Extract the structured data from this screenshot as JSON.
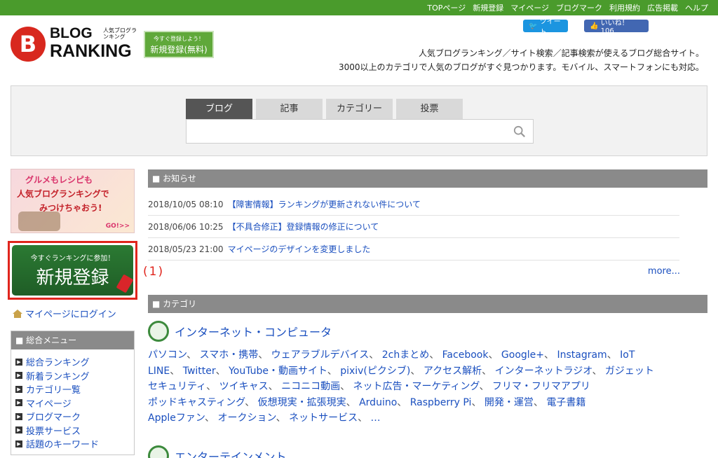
{
  "topnav": [
    "TOPページ",
    "新規登録",
    "マイページ",
    "ブログマーク",
    "利用規約",
    "広告掲載",
    "ヘルプ"
  ],
  "logo": {
    "mark": "B",
    "word1": "BLOG",
    "word2": "RANKING",
    "sub": "人気ブログランキング"
  },
  "header_register": {
    "small": "今すぐ登録しよう！",
    "big": "新規登録(無料)"
  },
  "social": {
    "tweet": "ツイート",
    "like": "いいね！ 106"
  },
  "tagline": [
    "人気ブログランキング／サイト検索／記事検索が使えるブログ総合サイト。",
    "3000以上のカテゴリで人気のブログがすぐ見つかります。モバイル、スマートフォンにも対応。"
  ],
  "search": {
    "tabs": [
      "ブログ",
      "記事",
      "カテゴリー",
      "投票"
    ],
    "active_tab": 0,
    "value": ""
  },
  "banner": {
    "line1": "グルメもレシピも",
    "line2": "人気ブログランキングで",
    "line3": "みつけちゃおう!",
    "go": "GO!>>"
  },
  "join": {
    "small": "今すぐランキングに参加！",
    "big": "新規登録"
  },
  "annotation": "(1)",
  "login": "マイページにログイン",
  "menu": {
    "title": "総合メニュー",
    "items": [
      "総合ランキング",
      "新着ランキング",
      "カテゴリ一覧",
      "マイページ",
      "ブログマーク",
      "投票サービス",
      "話題のキーワード"
    ]
  },
  "news": {
    "title": "お知らせ",
    "items": [
      {
        "date": "2018/10/05 08:10",
        "text": "【障害情報】ランキングが更新されない件について"
      },
      {
        "date": "2018/06/06 10:25",
        "text": "【不具合修正】登録情報の修正について"
      },
      {
        "date": "2018/05/23 21:00",
        "text": "マイページのデザインを変更しました"
      }
    ],
    "more": "more..."
  },
  "category": {
    "title": "カテゴリ",
    "main": "インターネット・コンピュータ",
    "lines": [
      [
        "パソコン",
        "スマホ・携帯",
        "ウェアラブルデバイス",
        "2chまとめ",
        "Facebook",
        "Google+",
        "Instagram",
        "IoT"
      ],
      [
        "LINE",
        "Twitter",
        "YouTube・動画サイト",
        "pixiv(ピクシブ)",
        "アクセス解析",
        "インターネットラジオ",
        "ガジェット"
      ],
      [
        "セキュリティ",
        "ツイキャス",
        "ニコニコ動画",
        "ネット広告・マーケティング",
        "フリマ・フリマアプリ"
      ],
      [
        "ポッドキャスティング",
        "仮想現実・拡張現実",
        "Arduino",
        "Raspberry Pi",
        "開発・運営",
        "電子書籍"
      ],
      [
        "Appleファン",
        "オークション",
        "ネットサービス",
        "…"
      ]
    ],
    "next": "エンターテインメント"
  },
  "colors": {
    "green": "#4a9b2c",
    "link": "#1a4fbf",
    "head_gray": "#8a8a8a",
    "red": "#e0251d"
  }
}
